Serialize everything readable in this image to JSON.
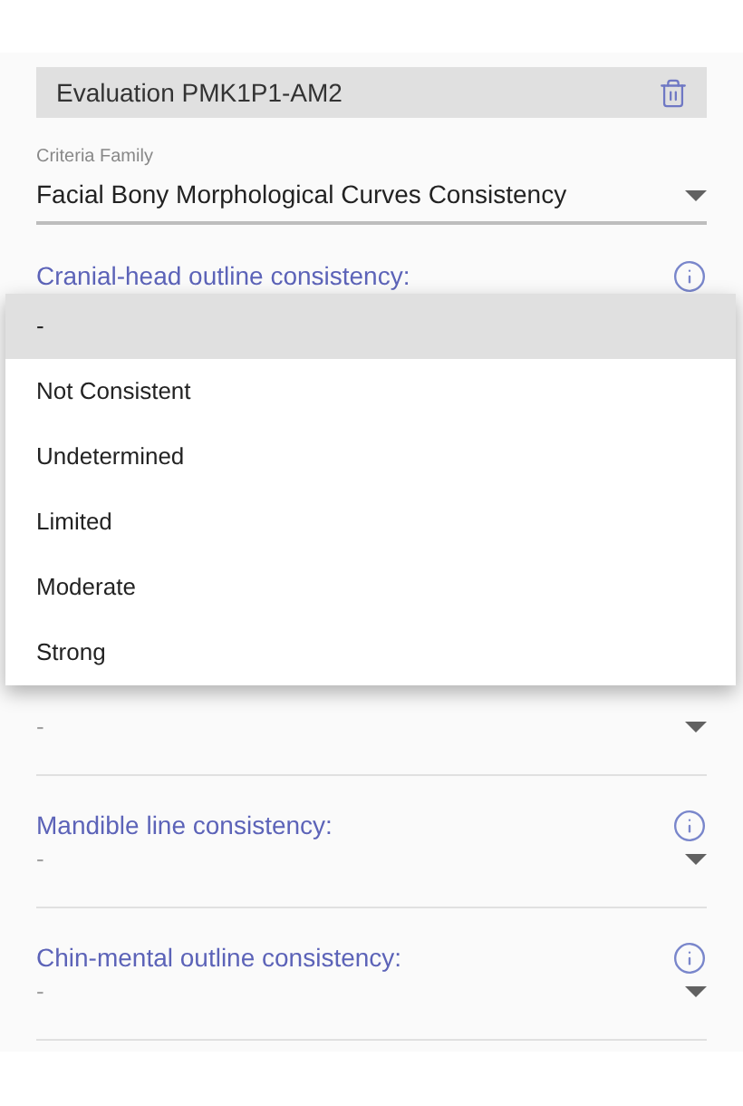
{
  "header": {
    "title": "Evaluation PMK1P1-AM2"
  },
  "criteria_family": {
    "label": "Criteria Family",
    "value": "Facial Bony Morphological Curves Consistency"
  },
  "fields": [
    {
      "label": "Cranial-head outline consistency:"
    },
    {
      "value": "-"
    },
    {
      "label": "Mandible line consistency:",
      "value": "-"
    },
    {
      "label": "Chin-mental outline consistency:",
      "value": "-"
    }
  ],
  "menu": {
    "options": [
      {
        "label": "-",
        "selected": true
      },
      {
        "label": "Not Consistent",
        "selected": false
      },
      {
        "label": "Undetermined",
        "selected": false
      },
      {
        "label": "Limited",
        "selected": false
      },
      {
        "label": "Moderate",
        "selected": false
      },
      {
        "label": "Strong",
        "selected": false
      }
    ]
  }
}
